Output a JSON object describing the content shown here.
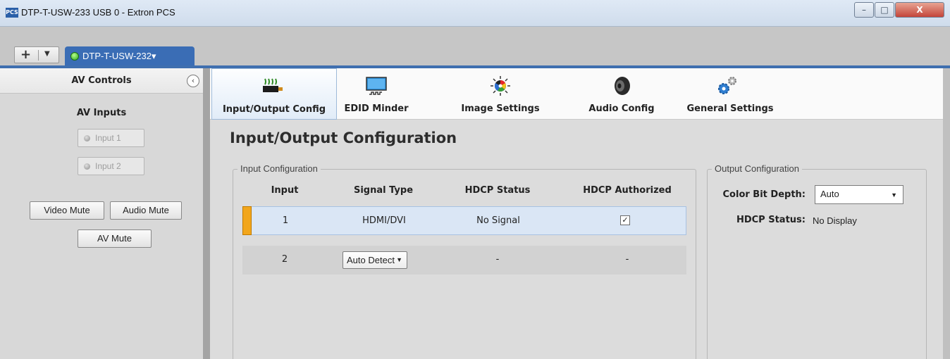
{
  "window": {
    "app_icon_text": "PCS",
    "title": "DTP-T-USW-233 USB 0 - Extron PCS",
    "minimize_glyph": "–",
    "maximize_glyph": "□",
    "close_glyph": "X"
  },
  "tabstrip": {
    "add_glyph": "+",
    "caret_glyph": "▼",
    "device_tab": {
      "name": "DTP-T-USW-232▾",
      "status_color": "#2bb01c"
    }
  },
  "left_panel": {
    "title": "AV Controls",
    "collapse_glyph": "‹",
    "section_title": "AV Inputs",
    "inputs": [
      {
        "label": "Input 1"
      },
      {
        "label": "Input 2"
      }
    ],
    "video_mute": "Video Mute",
    "audio_mute": "Audio Mute",
    "av_mute": "AV Mute"
  },
  "toolbar": {
    "items": [
      {
        "label": "Input/Output Config",
        "icon": "io-config-icon",
        "active": true
      },
      {
        "label": "EDID Minder",
        "icon": "monitor-icon"
      },
      {
        "label": "Image Settings",
        "icon": "color-wheel-icon"
      },
      {
        "label": "Audio Config",
        "icon": "speaker-icon"
      },
      {
        "label": "General Settings",
        "icon": "gears-icon"
      }
    ]
  },
  "page": {
    "title": "Input/Output Configuration",
    "input_config": {
      "legend": "Input Configuration",
      "columns": [
        "Input",
        "Signal Type",
        "HDCP Status",
        "HDCP Authorized"
      ],
      "rows": [
        {
          "input": "1",
          "signal_type": "HDMI/DVI",
          "hdcp_status": "No Signal",
          "hdcp_authorized_check": "✓",
          "selected": true
        },
        {
          "input": "2",
          "signal_type": "Auto Detect",
          "hdcp_status": "-",
          "hdcp_authorized": "-"
        }
      ],
      "dropdown_caret": "▼"
    },
    "output_config": {
      "legend": "Output Configuration",
      "color_bit_depth_label": "Color Bit Depth:",
      "color_bit_depth_value": "Auto",
      "hdcp_status_label": "HDCP Status:",
      "hdcp_status_value": "No Display"
    }
  },
  "colors": {
    "accent_blue": "#3a6db5",
    "selected_row": "#dae6f5",
    "row_marker": "#f2a61c"
  }
}
